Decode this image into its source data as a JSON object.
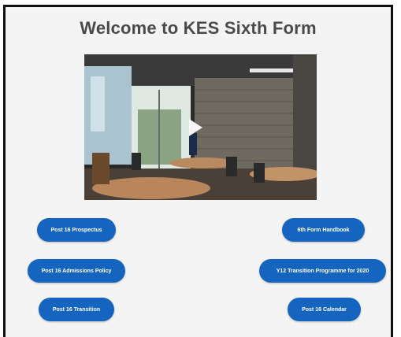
{
  "page": {
    "title": "Welcome to KES Sixth Form"
  },
  "video": {
    "play_icon": "play-icon"
  },
  "buttons": {
    "prospectus": "Post 16 Prospectus",
    "handbook": "6th Form Handbook",
    "admissions": "Post 16 Admissions Policy",
    "transition_programme": "Y12 Transition Programme for 2020",
    "transition": "Post 16 Transition",
    "calendar": "Post 16 Calendar"
  },
  "colors": {
    "button": "#1565c0",
    "title": "#4a4a4a",
    "background": "#f4f4f4"
  }
}
